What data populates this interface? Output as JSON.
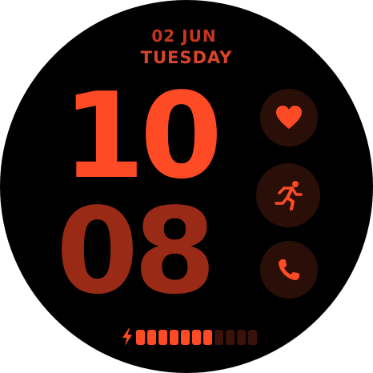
{
  "date": {
    "day_month": "02 JUN",
    "weekday": "TUESDAY"
  },
  "time": {
    "hours": "10",
    "minutes": "08"
  },
  "complications": [
    {
      "icon": "heart-icon"
    },
    {
      "icon": "running-icon"
    },
    {
      "icon": "phone-icon"
    }
  ],
  "battery": {
    "icon": "bolt-icon",
    "segments_total": 11,
    "segments_filled": 7,
    "level": 0.64
  },
  "colors": {
    "background": "#000000",
    "accent": "#ff4a26",
    "accent_dim": "#992a16",
    "date": "#c8351f",
    "complication_bg": "#2a0f08",
    "segment_off": "#3a120a"
  }
}
